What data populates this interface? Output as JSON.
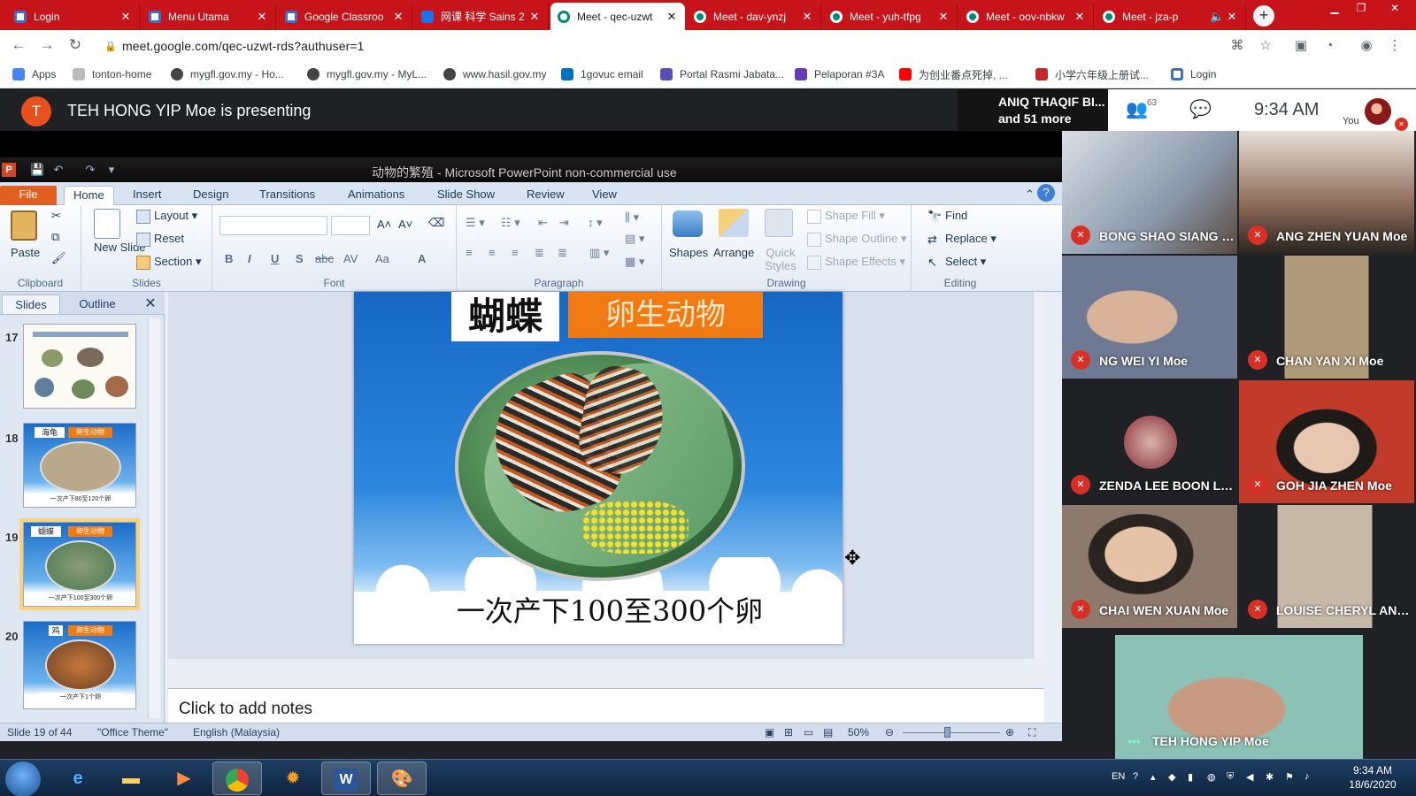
{
  "browser": {
    "tabs": [
      {
        "title": "Login",
        "favicon": "doc-icon",
        "active": false
      },
      {
        "title": "Menu Utama",
        "favicon": "doc-icon",
        "active": false
      },
      {
        "title": "Google Classroo",
        "favicon": "doc-icon",
        "active": false
      },
      {
        "title": "网课 科学 Sains 2",
        "favicon": "sains-icon",
        "active": false
      },
      {
        "title": "Meet - qec-uzwt",
        "favicon": "meet-icon",
        "active": true
      },
      {
        "title": "Meet - dav-ynzj",
        "favicon": "meet-icon",
        "active": false
      },
      {
        "title": "Meet - yuh-tfpg",
        "favicon": "meet-icon",
        "active": false
      },
      {
        "title": "Meet - oov-nbkw",
        "favicon": "meet-icon",
        "active": false
      },
      {
        "title": "Meet - jza-p",
        "favicon": "meet-icon",
        "active": false
      }
    ],
    "tab_close_glyph": "✕",
    "new_tab_glyph": "+",
    "url": "meet.google.com/qec-uzwt-rds?authuser=1",
    "bookmarks": [
      {
        "label": "Apps",
        "icon": "apps-grid-icon",
        "color": "#4285f4"
      },
      {
        "label": "tonton-home",
        "icon": "tonton-icon",
        "color": "#999999"
      },
      {
        "label": "mygfl.gov.my - Ho...",
        "icon": "globe-icon",
        "color": "#333333"
      },
      {
        "label": "mygfl.gov.my - MyL...",
        "icon": "globe-icon",
        "color": "#333333"
      },
      {
        "label": "www.hasil.gov.my",
        "icon": "globe-icon",
        "color": "#333333"
      },
      {
        "label": "1govuc email",
        "icon": "outlook-icon",
        "color": "#0072c6"
      },
      {
        "label": "Portal Rasmi Jabata...",
        "icon": "portal-icon",
        "color": "#5b4db8"
      },
      {
        "label": "Pelaporan #3A",
        "icon": "form-icon",
        "color": "#673ab7"
      },
      {
        "label": "为创业番点死掉, ...",
        "icon": "youtube-icon",
        "color": "#ff0000"
      },
      {
        "label": "小学六年级上册试...",
        "icon": "doc88-icon",
        "color": "#c62828"
      },
      {
        "label": "Login",
        "icon": "doc-icon",
        "color": "#3d6ec9"
      }
    ]
  },
  "meet": {
    "presenter_initial": "T",
    "presenting_text": "TEH HONG YIP Moe is presenting",
    "people_line1": "ANIQ THAQIF BI...",
    "people_line2": "and 51 more",
    "participant_count": "63",
    "clock": "9:34 AM",
    "you_label": "You",
    "participants": [
      {
        "name": "BONG SHAO SIANG Moe",
        "bg": "#7b8fa6"
      },
      {
        "name": "ANG ZHEN YUAN Moe",
        "bg": "#5c4a3c"
      },
      {
        "name": "NG WEI YI Moe",
        "bg": "#6e7a93"
      },
      {
        "name": "CHAN YAN XI Moe",
        "bg": "#9a8a6a"
      },
      {
        "name": "ZENDA LEE BOON LIAN...",
        "bg": "#202124"
      },
      {
        "name": "GOH JIA ZHEN Moe",
        "bg": "#8a3b2c"
      },
      {
        "name": "CHAI WEN XUAN Moe",
        "bg": "#6b5a4d"
      },
      {
        "name": "LOUISE CHERYL ANG LI...",
        "bg": "#a99b8b"
      }
    ],
    "main_speaker": "TEH HONG YIP Moe",
    "main_speaker_dots": "•••"
  },
  "ppt": {
    "window_title": "动物的繁殖 - Microsoft PowerPoint non-commercial use",
    "logo_letter": "P",
    "tabs": [
      "File",
      "Home",
      "Insert",
      "Design",
      "Transitions",
      "Animations",
      "Slide Show",
      "Review",
      "View"
    ],
    "groups": {
      "clipboard": {
        "label": "Clipboard",
        "paste": "Paste"
      },
      "slides": {
        "label": "Slides",
        "new_slide": "New Slide",
        "layout": "Layout",
        "reset": "Reset",
        "section": "Section"
      },
      "font": {
        "label": "Font",
        "bold": "B",
        "italic": "I",
        "underline": "U",
        "shadow": "S",
        "strike": "abc",
        "spacing": "AV",
        "case": "Aa",
        "color": "A"
      },
      "paragraph": {
        "label": "Paragraph"
      },
      "drawing": {
        "label": "Drawing",
        "shapes": "Shapes",
        "arrange": "Arrange",
        "quick_styles": "Quick Styles",
        "shape_fill": "Shape Fill",
        "shape_outline": "Shape Outline",
        "shape_effects": "Shape Effects"
      },
      "editing": {
        "label": "Editing",
        "find": "Find",
        "replace": "Replace",
        "select": "Select"
      }
    },
    "panel_tabs": [
      "Slides",
      "Outline"
    ],
    "thumbnails": [
      {
        "number": "17",
        "selected": false
      },
      {
        "number": "18",
        "selected": false,
        "title": "海龟",
        "category": "卵生动物",
        "caption": "一次产下80至120个卵"
      },
      {
        "number": "19",
        "selected": true,
        "title": "蝴蝶",
        "category": "卵生动物",
        "caption": "一次产下100至300个卵"
      },
      {
        "number": "20",
        "selected": false,
        "title": "鸡",
        "category": "卵生动物",
        "caption": "一次产下1个卵"
      }
    ],
    "slide": {
      "title": "蝴蝶",
      "category": "卵生动物",
      "caption": "一次产下100至300个卵"
    },
    "notes_placeholder": "Click to add notes",
    "status": {
      "slide_of": "Slide 19 of 44",
      "theme": "\"Office Theme\"",
      "language": "English (Malaysia)",
      "zoom": "50%",
      "zoom_fraction": 0.45
    }
  },
  "taskbar": {
    "apps": [
      "internet-explorer-icon",
      "file-explorer-icon",
      "media-player-icon",
      "chrome-icon",
      "sun-settings-icon",
      "word-icon",
      "paint-icon"
    ],
    "word_letter": "W",
    "language": "EN",
    "time": "9:34 AM",
    "date": "18/6/2020"
  }
}
